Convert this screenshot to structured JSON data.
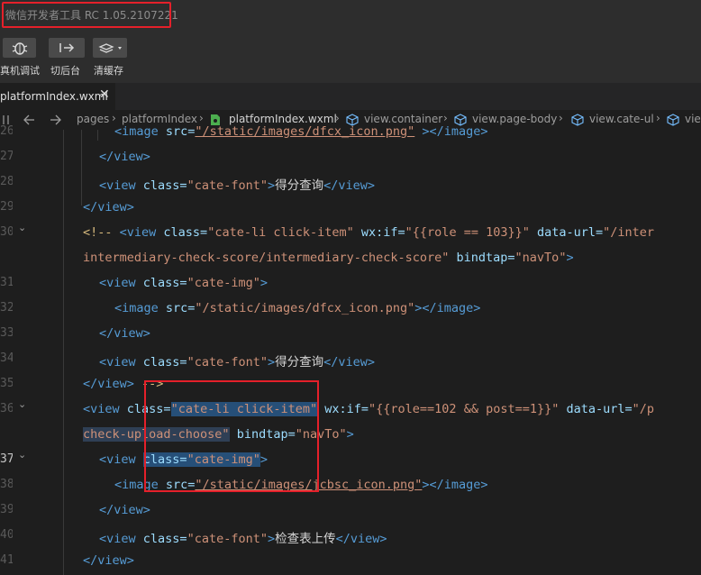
{
  "window": {
    "title": "微信开发者工具 RC 1.05.2107221"
  },
  "toolbar": {
    "real_device": "真机调试",
    "background": "切后台",
    "clear_cache": "清缓存"
  },
  "tab": {
    "label": "platformIndex.wxml",
    "close": "✕"
  },
  "breadcrumb": {
    "items": [
      "pages",
      "platformIndex",
      "platformIndex.wxml",
      "view.container",
      "view.page-body",
      "view.cate-ul",
      "vie"
    ]
  },
  "line_numbers": [
    "26",
    "27",
    "28",
    "29",
    "30",
    "",
    "31",
    "32",
    "33",
    "34",
    "35",
    "36",
    "",
    "37",
    "38",
    "39",
    "40",
    "41"
  ],
  "code": {
    "l1": {
      "t1": "<image ",
      "a1": "src=",
      "s1": "\"/static/images/dfcx_icon.png\"",
      "t2": " ></image>"
    },
    "l2": {
      "t1": "</view>"
    },
    "l3": {
      "t1": "<view ",
      "a1": "class=",
      "s1": "\"cate-font\"",
      "t2": ">",
      "text": "得分查询",
      "t3": "</view>"
    },
    "l4": {
      "t1": "</view>"
    },
    "l5": {
      "c1": "<!-- ",
      "t1": "<view ",
      "a1": "class=",
      "s1": "\"cate-li click-item\"",
      "a2": " wx:if=",
      "s2": "\"{{role == 103}}\"",
      "a3": " data-url=",
      "s3": "\"/inter"
    },
    "l6": {
      "s1": "intermediary-check-score/intermediary-check-score\"",
      "a1": " bindtap=",
      "s2": "\"navTo\"",
      "t1": ">"
    },
    "l7": {
      "t1": "<view ",
      "a1": "class=",
      "s1": "\"cate-img\"",
      "t2": ">"
    },
    "l8": {
      "t1": "<image ",
      "a1": "src=",
      "s1": "\"/static/images/dfcx_icon.png\"",
      "t2": "></image>"
    },
    "l9": {
      "t1": "</view>"
    },
    "l10": {
      "t1": "<view ",
      "a1": "class=",
      "s1": "\"cate-font\"",
      "t2": ">",
      "text": "得分查询",
      "t3": "</view>"
    },
    "l11": {
      "t1": "</view> ",
      "c1": "-->"
    },
    "l12": {
      "t1": "<view ",
      "a1": "class=",
      "s1": "\"cate-li click-item\"",
      "a2": " wx:if=",
      "s2": "\"{{role==102 && post==1}}\"",
      "a3": " data-url=",
      "s3": "\"/p"
    },
    "l13": {
      "s1": "check-upload-choose\"",
      "a1": " bindtap=",
      "s2": "\"navTo\"",
      "t1": ">"
    },
    "l14": {
      "t1": "<view ",
      "a1": "class=",
      "s1": "\"cate-img\"",
      "t2": ">"
    },
    "l15": {
      "t1": "<image ",
      "a1": "src=",
      "s1": "\"/static/images/jcbsc_icon.png\"",
      "t2": "></image>"
    },
    "l16": {
      "t1": "</view>"
    },
    "l17": {
      "t1": "<view ",
      "a1": "class=",
      "s1": "\"cate-font\"",
      "t2": ">",
      "text": "检查表上传",
      "t3": "</view>"
    },
    "l18": {
      "t1": "</view>"
    }
  },
  "colors": {
    "tag": "#569cd6",
    "attribute": "#9cdcfe",
    "string": "#ce9178",
    "comment_marker": "#d7ba7d",
    "highlight": "#e5202a"
  }
}
